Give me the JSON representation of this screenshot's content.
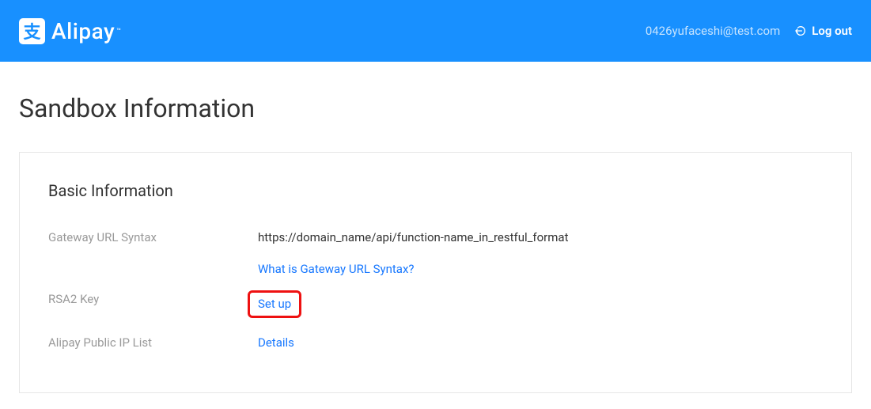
{
  "header": {
    "brand_glyph": "支",
    "brand_name": "Alipay",
    "brand_tm": "™",
    "user_email": "0426yufaceshi@test.com",
    "logout_label": "Log out"
  },
  "page": {
    "title": "Sandbox Information"
  },
  "basic_info": {
    "section_title": "Basic Information",
    "gateway": {
      "label": "Gateway URL Syntax",
      "value": "https://domain_name/api/function-name_in_restful_format",
      "help_link": "What is Gateway URL Syntax?"
    },
    "rsa2": {
      "label": "RSA2 Key",
      "action": "Set up"
    },
    "ip_list": {
      "label": "Alipay Public IP List",
      "action": "Details"
    }
  }
}
